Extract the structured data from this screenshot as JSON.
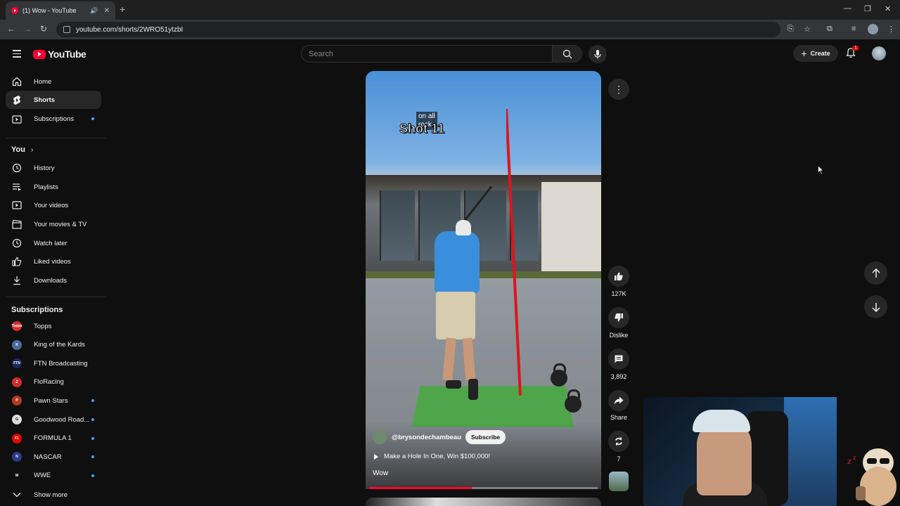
{
  "browser": {
    "tab_title": "(1) Wow - YouTube",
    "url": "youtube.com/shorts/2WRO51ytzbI"
  },
  "header": {
    "logo": "YouTube",
    "search_placeholder": "Search",
    "create_label": "Create",
    "notification_count": "1"
  },
  "sidebar": {
    "main": [
      {
        "label": "Home"
      },
      {
        "label": "Shorts"
      },
      {
        "label": "Subscriptions"
      }
    ],
    "you_heading": "You",
    "you_items": [
      {
        "label": "History"
      },
      {
        "label": "Playlists"
      },
      {
        "label": "Your videos"
      },
      {
        "label": "Your movies & TV"
      },
      {
        "label": "Watch later"
      },
      {
        "label": "Liked videos"
      },
      {
        "label": "Downloads"
      }
    ],
    "subs_heading": "Subscriptions",
    "subscriptions": [
      {
        "label": "Topps",
        "badge": "Topps",
        "color": "#d62d2d"
      },
      {
        "label": "King of the Kards",
        "badge": "K",
        "color": "#4a6a9a"
      },
      {
        "label": "FTN Broadcasting",
        "badge": "FTN",
        "color": "#1a2a5a"
      },
      {
        "label": "FloRacing",
        "badge": "Z",
        "color": "#d42b2b"
      },
      {
        "label": "Pawn Stars",
        "badge": "P",
        "color": "#b53a22"
      },
      {
        "label": "Goodwood Road...",
        "badge": "G",
        "color": "#dddddd"
      },
      {
        "label": "FORMULA 1",
        "badge": "F1",
        "color": "#e10600"
      },
      {
        "label": "NASCAR",
        "badge": "N",
        "color": "#2b3a8f"
      },
      {
        "label": "WWE",
        "badge": "W",
        "color": "#111111"
      }
    ],
    "show_more": "Show more"
  },
  "short": {
    "caption_small": "on all rock",
    "caption_big": "Shot 11",
    "channel": "@brysondechambeau",
    "subscribe_label": "Subscribe",
    "related_video": "Make a Hole In One, Win $100,000!",
    "title": "Wow",
    "progress_percent": 45
  },
  "actions": {
    "likes": "127K",
    "dislike_label": "Dislike",
    "comments": "3,892",
    "share_label": "Share",
    "remix_count": "7"
  }
}
